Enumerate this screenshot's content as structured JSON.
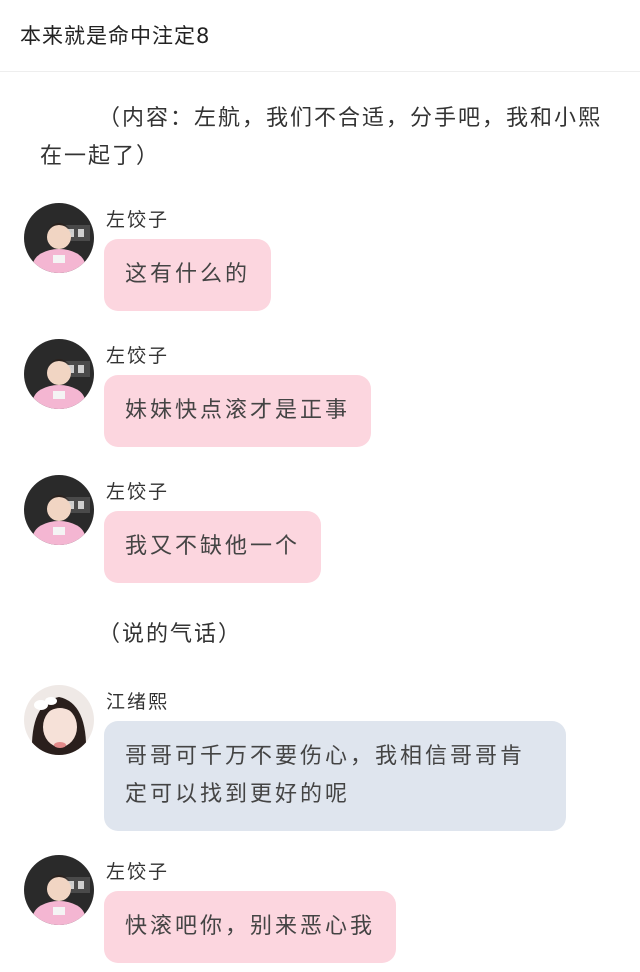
{
  "header": {
    "title": "本来就是命中注定8"
  },
  "narration": [
    "（内容：左航，我们不合适，分手吧，我和小熙在一起了）",
    "（说的气话）"
  ],
  "messages": [
    {
      "sender": "左饺子",
      "text": "这有什么的",
      "avatar": "boy-pink-shirt-avatar",
      "bubble_color": "#fcd6df"
    },
    {
      "sender": "左饺子",
      "text": "妹妹快点滚才是正事",
      "avatar": "boy-pink-shirt-avatar",
      "bubble_color": "#fcd6df"
    },
    {
      "sender": "左饺子",
      "text": "我又不缺他一个",
      "avatar": "boy-pink-shirt-avatar",
      "bubble_color": "#fcd6df"
    },
    {
      "sender": "江绪熙",
      "text": "哥哥可千万不要伤心，我相信哥哥肯定可以找到更好的呢",
      "avatar": "girl-selfie-avatar",
      "bubble_color": "#dfe5ee"
    },
    {
      "sender": "左饺子",
      "text": "快滚吧你，别来恶心我",
      "avatar": "boy-pink-shirt-avatar",
      "bubble_color": "#fcd6df"
    }
  ]
}
